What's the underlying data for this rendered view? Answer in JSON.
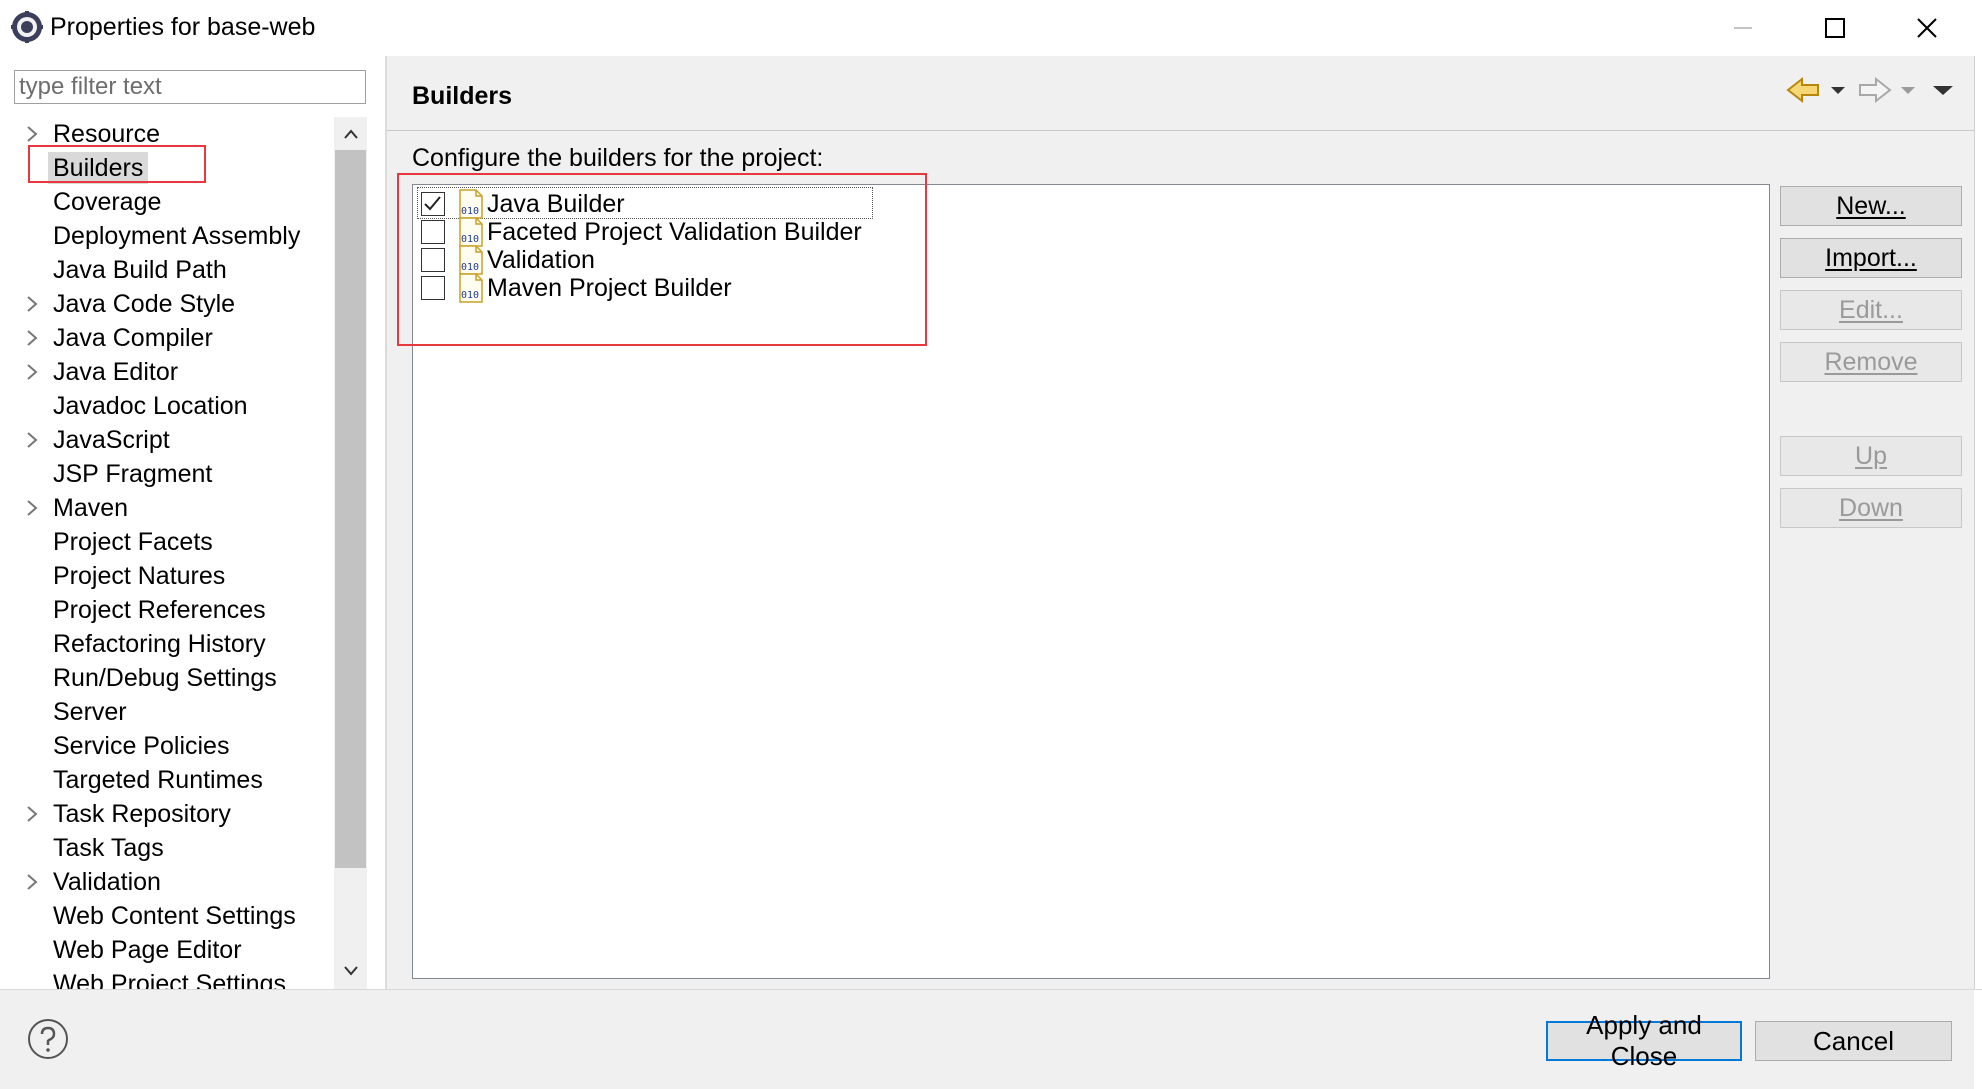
{
  "window": {
    "title": "Properties for base-web"
  },
  "filter": {
    "placeholder": "type filter text"
  },
  "nav": {
    "items": [
      {
        "label": "Resource",
        "expandable": true
      },
      {
        "label": "Builders",
        "expandable": false,
        "selected": true
      },
      {
        "label": "Coverage",
        "expandable": false
      },
      {
        "label": "Deployment Assembly",
        "expandable": false
      },
      {
        "label": "Java Build Path",
        "expandable": false
      },
      {
        "label": "Java Code Style",
        "expandable": true
      },
      {
        "label": "Java Compiler",
        "expandable": true
      },
      {
        "label": "Java Editor",
        "expandable": true
      },
      {
        "label": "Javadoc Location",
        "expandable": false
      },
      {
        "label": "JavaScript",
        "expandable": true
      },
      {
        "label": "JSP Fragment",
        "expandable": false
      },
      {
        "label": "Maven",
        "expandable": true
      },
      {
        "label": "Project Facets",
        "expandable": false
      },
      {
        "label": "Project Natures",
        "expandable": false
      },
      {
        "label": "Project References",
        "expandable": false
      },
      {
        "label": "Refactoring History",
        "expandable": false
      },
      {
        "label": "Run/Debug Settings",
        "expandable": false
      },
      {
        "label": "Server",
        "expandable": false
      },
      {
        "label": "Service Policies",
        "expandable": false
      },
      {
        "label": "Targeted Runtimes",
        "expandable": false
      },
      {
        "label": "Task Repository",
        "expandable": true
      },
      {
        "label": "Task Tags",
        "expandable": false
      },
      {
        "label": "Validation",
        "expandable": true
      },
      {
        "label": "Web Content Settings",
        "expandable": false
      },
      {
        "label": "Web Page Editor",
        "expandable": false
      },
      {
        "label": "Web Project Settings",
        "expandable": false
      }
    ]
  },
  "page": {
    "title": "Builders",
    "description": "Configure the builders for the project:"
  },
  "builders": [
    {
      "label": "Java Builder",
      "checked": true,
      "icon": "binary-file-icon"
    },
    {
      "label": "Faceted Project Validation Builder",
      "checked": false,
      "icon": "binary-file-icon"
    },
    {
      "label": "Validation",
      "checked": false,
      "icon": "binary-file-icon"
    },
    {
      "label": "Maven Project Builder",
      "checked": false,
      "icon": "binary-file-icon"
    }
  ],
  "buttons": {
    "new": {
      "label": "New...",
      "mnemonic": "N",
      "enabled": true
    },
    "import": {
      "label": "Import...",
      "mnemonic": "I",
      "enabled": true
    },
    "edit": {
      "label": "Edit...",
      "mnemonic": "E",
      "enabled": false
    },
    "remove": {
      "label": "Remove",
      "mnemonic": "R",
      "enabled": false
    },
    "up": {
      "label": "Up",
      "mnemonic": "U",
      "enabled": false
    },
    "down": {
      "label": "Down",
      "mnemonic": "D",
      "enabled": false
    },
    "apply_close": "Apply and Close",
    "cancel": "Cancel"
  },
  "colors": {
    "highlight_box": "#e8383d",
    "default_button_border": "#0078d7",
    "selection_bg": "#d9d9d9"
  }
}
